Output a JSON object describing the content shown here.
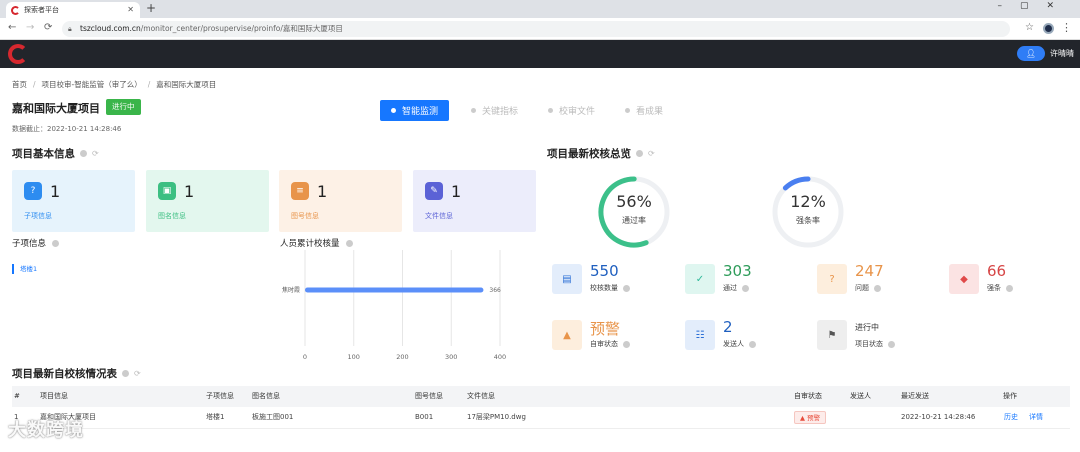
{
  "browser": {
    "tab_title": "探索者平台",
    "url_domain": "tszcloud.com.cn",
    "url_path": "/monitor_center/prosupervise/proinfo/嘉和国际大厦项目"
  },
  "header": {
    "user_name": "许晴晴"
  },
  "breadcrumb": [
    "首页",
    "项目校审-智能监管（审了么）",
    "嘉和国际大厦项目"
  ],
  "project": {
    "title": "嘉和国际大厦项目",
    "status": "进行中",
    "as_of": "数据截止：2022-10-21 14:28:46"
  },
  "steps": [
    {
      "label": "智能监测",
      "active": true
    },
    {
      "label": "关键指标",
      "active": false
    },
    {
      "label": "校审文件",
      "active": false
    },
    {
      "label": "看成果",
      "active": false
    }
  ],
  "basic_info": {
    "title": "项目基本信息",
    "cards": [
      {
        "label": "子项信息",
        "value": "1",
        "icon": "question-icon",
        "bg": "#e6f3fc",
        "iconbg": "#2d8cf0",
        "labelcolor": "#2d8cf0"
      },
      {
        "label": "图名信息",
        "value": "1",
        "icon": "image-icon",
        "bg": "#e3f7ee",
        "iconbg": "#3cbf82",
        "labelcolor": "#3cbf82"
      },
      {
        "label": "图号信息",
        "value": "1",
        "icon": "list-icon",
        "bg": "#fdf1e6",
        "iconbg": "#e8944a",
        "labelcolor": "#e8944a"
      },
      {
        "label": "文件信息",
        "value": "1",
        "icon": "file-icon",
        "bg": "#ecedfb",
        "iconbg": "#5b62d6",
        "labelcolor": "#5b62d6"
      }
    ],
    "sub_title": "子项信息",
    "sub_item": "塔楼1",
    "chart_title": "人员累计校核量"
  },
  "chart_data": {
    "type": "bar",
    "orientation": "horizontal",
    "title": "人员累计校核量",
    "categories": [
      "焦时霞"
    ],
    "values": [
      366
    ],
    "xticks": [
      0,
      100,
      200,
      300,
      400
    ],
    "xlim": [
      0,
      400
    ],
    "color": "#5b8ff9",
    "grid": true
  },
  "overview": {
    "title": "项目最新校核总览",
    "rings": [
      {
        "value": "56%",
        "fraction": 0.56,
        "label": "通过率",
        "color": "#3cc08a"
      },
      {
        "value": "12%",
        "fraction": 0.12,
        "label": "强条率",
        "color": "#4a7ff0"
      }
    ],
    "stats": [
      {
        "value": "550",
        "label": "校核数量",
        "icon": "doc-icon",
        "color": "#1f5fbf",
        "bg": "#e3edfb",
        "iconcolor": "#2b6fd6"
      },
      {
        "value": "303",
        "label": "通过",
        "icon": "check-icon",
        "color": "#2e9c5a",
        "bg": "#dff6f0",
        "iconcolor": "#2fb99a"
      },
      {
        "value": "247",
        "label": "问题",
        "icon": "question-icon",
        "color": "#e8944a",
        "bg": "#fdeedd",
        "iconcolor": "#e8944a"
      },
      {
        "value": "66",
        "label": "强条",
        "icon": "bookmark-icon",
        "color": "#d64545",
        "bg": "#fbe3e3",
        "iconcolor": "#e04a4a"
      },
      {
        "value": "预警",
        "label": "自审状态",
        "icon": "warning-icon",
        "color": "#e8944a",
        "bg": "#fdeedd",
        "iconcolor": "#e8944a"
      },
      {
        "value": "2",
        "label": "发送人",
        "icon": "people-icon",
        "color": "#1f5fbf",
        "bg": "#e3edfb",
        "iconcolor": "#2b6fd6"
      },
      {
        "value": "进行中",
        "label": "项目状态",
        "icon": "flag-icon",
        "color": "#333333",
        "bg": "#eeeeee",
        "iconcolor": "#555555"
      }
    ]
  },
  "self_check": {
    "title": "项目最新自校核情况表",
    "columns": [
      "#",
      "项目信息",
      "子项信息",
      "图名信息",
      "图号信息",
      "文件信息",
      "自审状态",
      "发送人",
      "最近发送",
      "操作"
    ],
    "rows": [
      {
        "idx": "1",
        "project": "嘉和国际大厦项目",
        "sub": "塔楼1",
        "drawing_name": "板施工图001",
        "drawing_no": "B001",
        "file": "17层梁PM10.dwg",
        "status": "预警",
        "sender": "",
        "last_sent": "2022-10-21 14:28:46",
        "op1": "历史",
        "op2": "详情"
      }
    ]
  },
  "watermark": "大数跨境"
}
